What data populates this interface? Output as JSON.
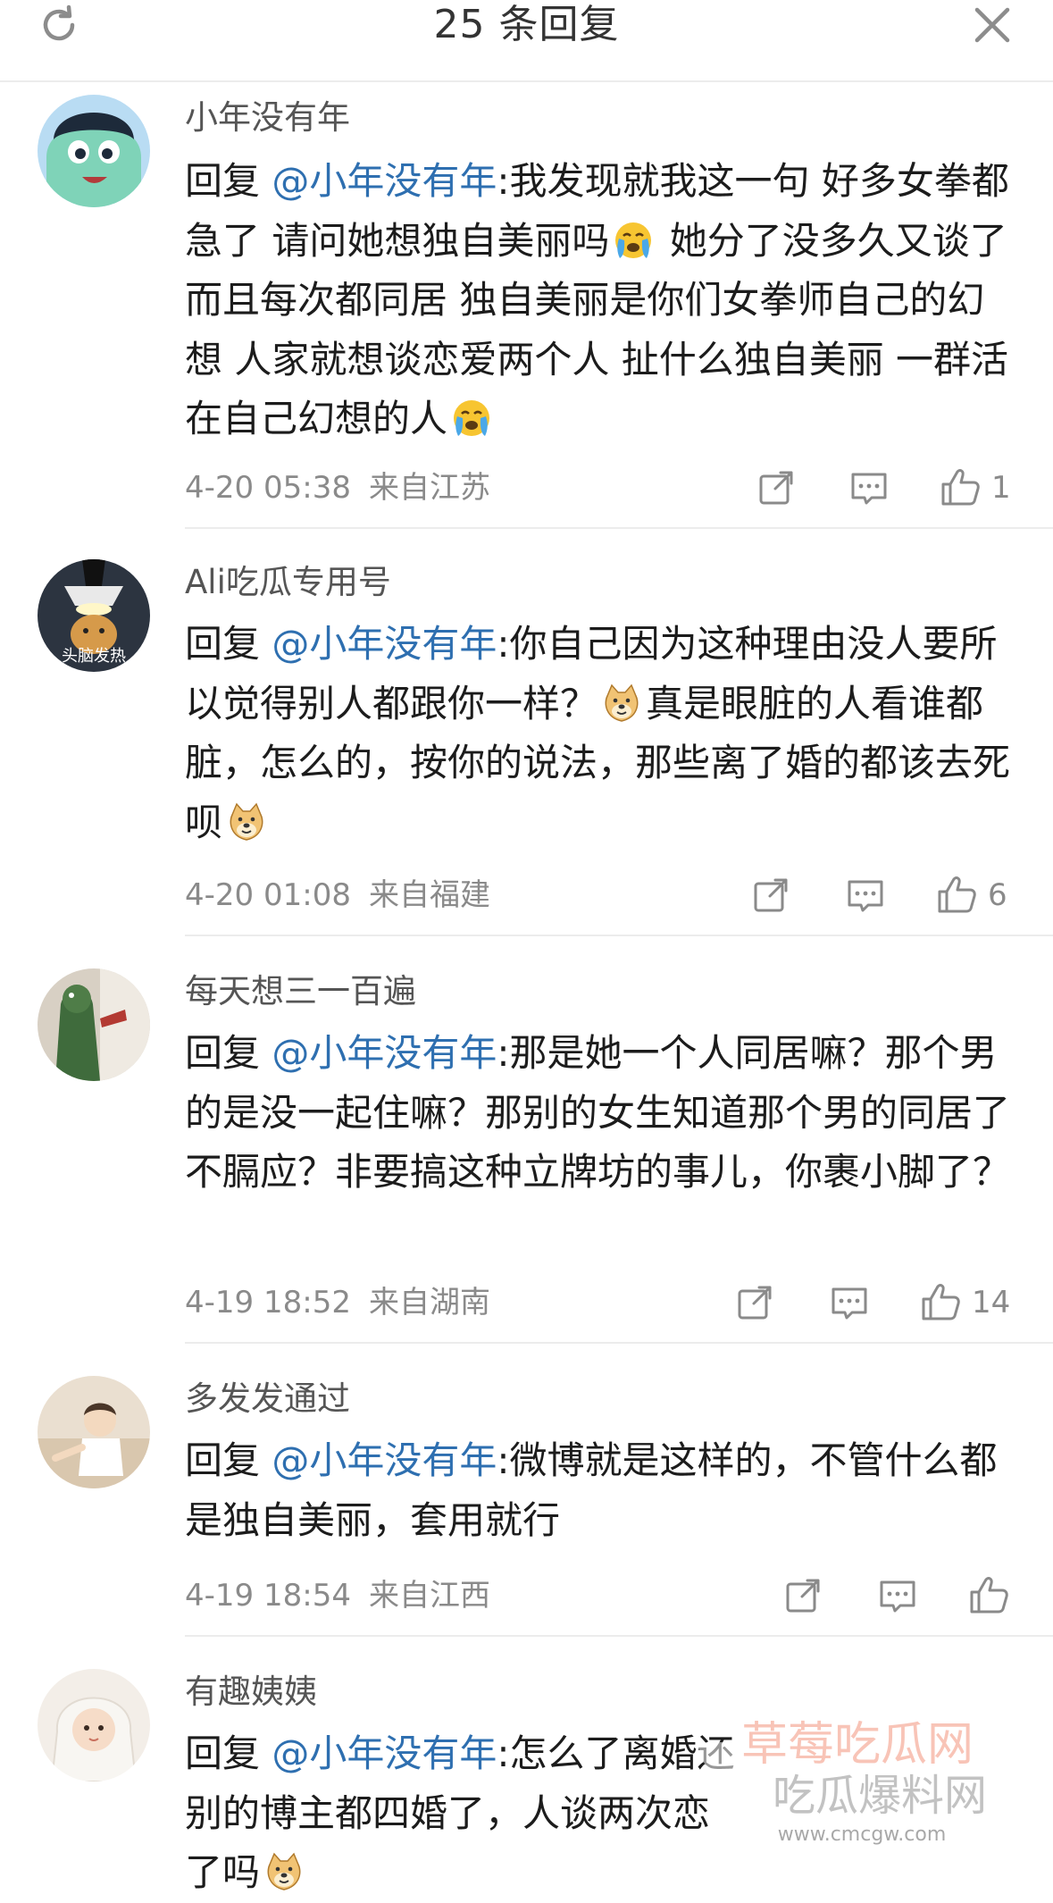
{
  "header": {
    "title": "25 条回复",
    "refresh_icon": "refresh-icon",
    "close_icon": "close-icon"
  },
  "colors": {
    "mention": "#2e6fb0",
    "meta": "#8a8a8a",
    "divider": "#ececec"
  },
  "comments": [
    {
      "username": "小年没有年",
      "reply_prefix": "回复 ",
      "mention": "@小年没有年",
      "text_parts": [
        ":我发现就我这一句 好多女拳都急了 请问她想独自美丽吗",
        " 她分了没多久又谈了 而且每次都同居 独自美丽是你们女拳师自己的幻想 人家就想谈恋爱两个人 扯什么独自美丽 一群活在自己幻想的人"
      ],
      "emojis": [
        "crying-emoji",
        "crying-emoji"
      ],
      "date": "4-20 05:38",
      "location": "来自江苏",
      "likes": "1"
    },
    {
      "username": "Ali吃瓜专用号",
      "avatar_caption": "头脑发热",
      "reply_prefix": "回复 ",
      "mention": "@小年没有年",
      "text_parts": [
        ":你自己因为这种理由没人要所以觉得别人都跟你一样？",
        "真是眼脏的人看谁都脏，怎么的，按你的说法，那些离了婚的都该去死呗"
      ],
      "emojis": [
        "doge-emoji",
        "doge-emoji"
      ],
      "date": "4-20 01:08",
      "location": "来自福建",
      "likes": "6"
    },
    {
      "username": "每天想三一百遍",
      "reply_prefix": "回复 ",
      "mention": "@小年没有年",
      "text_parts": [
        ":那是她一个人同居嘛？那个男的是没一起住嘛？那别的女生知道那个男的同居了不膈应？非要搞这种立牌坊的事儿，你裹小脚了？"
      ],
      "date": "4-19 18:52",
      "location": "来自湖南",
      "likes": "14"
    },
    {
      "username": "多发发通过",
      "reply_prefix": "回复 ",
      "mention": "@小年没有年",
      "text_parts": [
        ":微博就是这样的，不管什么都是独自美丽，套用就行"
      ],
      "date": "4-19 18:54",
      "location": "来自江西",
      "likes": ""
    },
    {
      "username": "有趣姨姨",
      "reply_prefix": "回复 ",
      "mention": "@小年没有年",
      "text_parts": [
        ":怎么了离婚还",
        "别的博主都四婚了，人谈两次恋",
        "了吗"
      ],
      "emojis": [
        "doge-emoji"
      ]
    }
  ],
  "watermark": {
    "line1": "草莓吃瓜网",
    "line2": "吃瓜爆料网",
    "url": "www.cmcgw.com"
  }
}
